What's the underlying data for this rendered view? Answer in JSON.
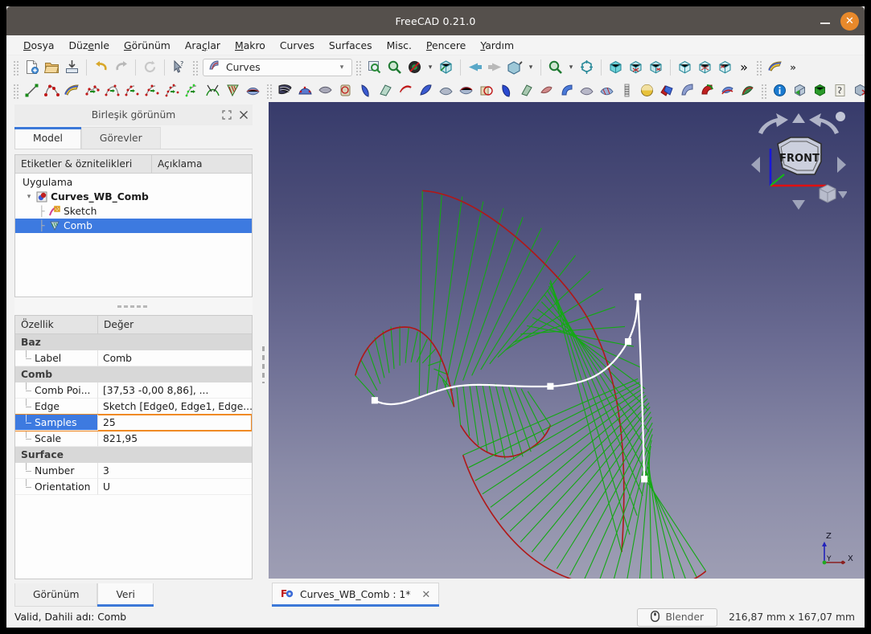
{
  "window": {
    "title": "FreeCAD 0.21.0",
    "minimize_label": "–",
    "close_label": "✕"
  },
  "menubar": {
    "items": [
      {
        "name": "file",
        "pre": "",
        "mnem": "D",
        "post": "osya"
      },
      {
        "name": "edit",
        "pre": "Düz",
        "mnem": "e",
        "post": "nle"
      },
      {
        "name": "view",
        "pre": "",
        "mnem": "G",
        "post": "örünüm"
      },
      {
        "name": "tools",
        "pre": "Ara",
        "mnem": "ç",
        "post": "lar"
      },
      {
        "name": "macro",
        "pre": "",
        "mnem": "M",
        "post": "akro"
      },
      {
        "name": "curves",
        "pre": "Curves",
        "mnem": "",
        "post": ""
      },
      {
        "name": "surfaces",
        "pre": "Surfaces",
        "mnem": "",
        "post": ""
      },
      {
        "name": "misc",
        "pre": "Misc.",
        "mnem": "",
        "post": ""
      },
      {
        "name": "windows",
        "pre": "",
        "mnem": "P",
        "post": "encere"
      },
      {
        "name": "help",
        "pre": "",
        "mnem": "Y",
        "post": "ardım"
      }
    ]
  },
  "toolbar": {
    "workbench": {
      "label": "Curves",
      "icon": "curves-workbench-icon",
      "arrow": "▾"
    },
    "overflow_label": "»",
    "row1_icons": [
      "new-document-icon",
      "open-document-icon",
      "save-document-icon",
      "undo-icon",
      "redo-icon",
      "refresh-icon",
      "whats-this-icon"
    ],
    "row1_view_icons": [
      "fit-selection-icon",
      "zoom-box-icon",
      "clipping-icon",
      "std-view-dropdown-icon",
      "isometric-icon",
      "back-view-icon",
      "forward-view-icon",
      "axonometric-icon",
      "zoom-icon",
      "fit-all-icon",
      "front-face-icon",
      "top-face-icon",
      "right-face-icon",
      "rear-face-icon",
      "bottom-face-icon",
      "left-face-icon"
    ],
    "row2_icons": [
      "line-icon",
      "bspline-icon",
      "editable-spline-icon",
      "join-curve-icon",
      "split-curve-icon",
      "discretize-icon",
      "approximate-icon",
      "interpolate-icon",
      "parametric-blend-icon",
      "comb-plot-icon",
      "zebra-icon",
      "gordon-surface-icon",
      "isocurve-icon",
      "sweep2rails-icon",
      "profile-support-icon",
      "pipeshell-icon",
      "segment-surface-icon",
      "flatten-face-icon",
      "curve-extend-icon",
      "sublink-icon",
      "trim-face-icon",
      "sketch-on-surface-icon",
      "solid-icon",
      "blend-surface-icon",
      "mixed-curve-icon",
      "reflect-lines-icon",
      "info-icon",
      "bounding-box-icon",
      "solid-green-icon",
      "sketch-export-icon",
      "face-map-icon",
      "grid-icon",
      "point-cloud-icon"
    ]
  },
  "left_dock": {
    "title": "Birleşik görünüm",
    "float_icon": "restore-icon",
    "close_icon": "close-icon",
    "tabs": [
      {
        "label": "Model",
        "active": true
      },
      {
        "label": "Görevler",
        "active": false
      }
    ],
    "tree": {
      "headers": [
        "Etiketler & öznitelikleri",
        "Açıklama"
      ],
      "root": "Uygulama",
      "nodes": [
        {
          "label": "Curves_WB_Comb",
          "icon": "document-icon",
          "depth": 1,
          "bold": true,
          "selected": false,
          "arrow": "⌄"
        },
        {
          "label": "Sketch",
          "icon": "sketch-icon",
          "depth": 2,
          "bold": false,
          "selected": false,
          "arrow": ""
        },
        {
          "label": "Comb",
          "icon": "comb-icon",
          "depth": 2,
          "bold": false,
          "selected": true,
          "arrow": ""
        }
      ]
    },
    "properties": {
      "headers": [
        "Özellik",
        "Değer"
      ],
      "rows": [
        {
          "type": "group",
          "name": "Baz"
        },
        {
          "type": "prop",
          "name": "Label",
          "value": "Comb",
          "selected": false
        },
        {
          "type": "group",
          "name": "Comb"
        },
        {
          "type": "prop",
          "name": "Comb Poi...",
          "value": "[37,53 -0,00 8,86], ...",
          "selected": false
        },
        {
          "type": "prop",
          "name": "Edge",
          "value": "Sketch [Edge0, Edge1, Edge...",
          "selected": false
        },
        {
          "type": "prop",
          "name": "Samples",
          "value": "25",
          "selected": true
        },
        {
          "type": "prop",
          "name": "Scale",
          "value": "821,95",
          "selected": false
        },
        {
          "type": "group",
          "name": "Surface"
        },
        {
          "type": "prop",
          "name": "Number",
          "value": "3",
          "selected": false
        },
        {
          "type": "prop",
          "name": "Orientation",
          "value": "U",
          "selected": false
        }
      ]
    },
    "bottom_tabs": [
      {
        "label": "Görünüm",
        "active": false
      },
      {
        "label": "Veri",
        "active": true
      }
    ]
  },
  "statusbar": {
    "message": "Valid, Dahili adı: Comb"
  },
  "document_tabs": [
    {
      "label": "Curves_WB_Comb : 1*",
      "icon": "freecad-doc-icon",
      "close": "✕",
      "active": true
    }
  ],
  "status_right": {
    "blender_label": "Blender",
    "blender_icon": "mouse-icon",
    "dimensions": "216,87 mm x 167,07 mm"
  },
  "viewport": {
    "nav_cube_label": "FRONT",
    "nav_cube_icons": [
      "rotate-left-arrow-icon",
      "rotate-right-arrow-icon",
      "arrow-up-icon",
      "arrow-down-icon",
      "arrow-left-icon",
      "arrow-right-icon",
      "corner-dot-icon",
      "view-menu-cube-icon",
      "chevron-down-icon"
    ],
    "axis_labels": {
      "z": "Z",
      "y": "Y",
      "x": "X"
    },
    "colors": {
      "curve": "#ffffff",
      "comb_envelope": "#b01818",
      "comb_quills": "#14a814",
      "background_top": "#373b6b",
      "background_bottom": "#9e9eb4",
      "axis_x": "#c00000",
      "axis_y": "#00a000",
      "axis_z": "#1818c8"
    }
  }
}
